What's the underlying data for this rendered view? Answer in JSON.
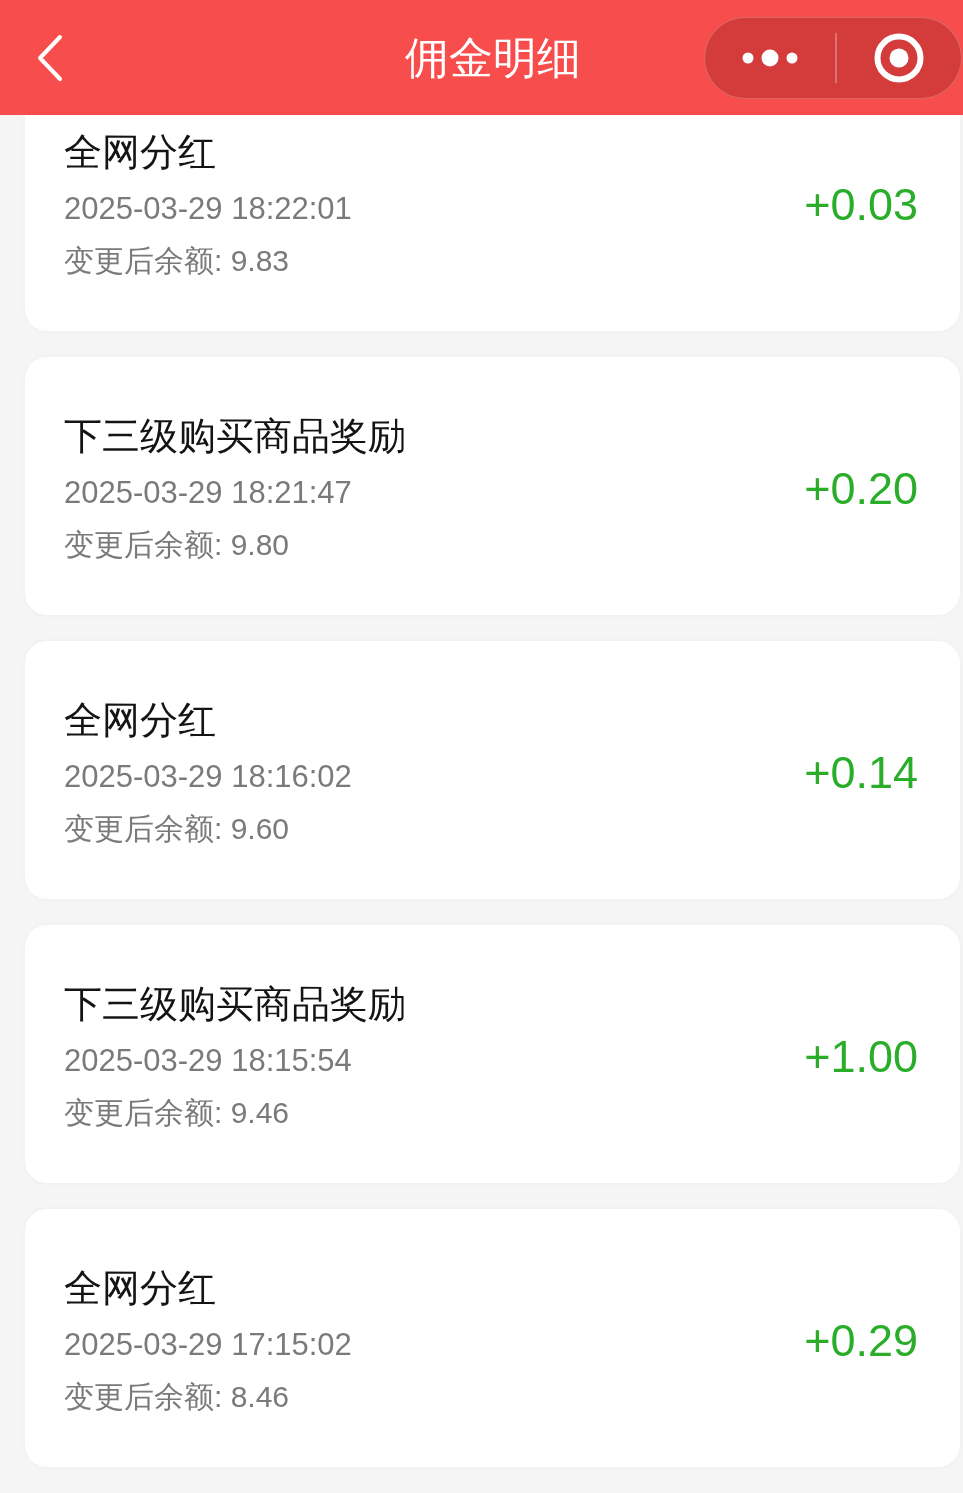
{
  "header": {
    "title": "佣金明细"
  },
  "records": [
    {
      "title": "全网分红",
      "time": "2025-03-29 18:22:01",
      "balance": "变更后余额: 9.83",
      "amount": "+0.03"
    },
    {
      "title": "下三级购买商品奖励",
      "time": "2025-03-29 18:21:47",
      "balance": "变更后余额: 9.80",
      "amount": "+0.20"
    },
    {
      "title": "全网分红",
      "time": "2025-03-29 18:16:02",
      "balance": "变更后余额: 9.60",
      "amount": "+0.14"
    },
    {
      "title": "下三级购买商品奖励",
      "time": "2025-03-29 18:15:54",
      "balance": "变更后余额: 9.46",
      "amount": "+1.00"
    },
    {
      "title": "全网分红",
      "time": "2025-03-29 17:15:02",
      "balance": "变更后余额: 8.46",
      "amount": "+0.29"
    }
  ]
}
